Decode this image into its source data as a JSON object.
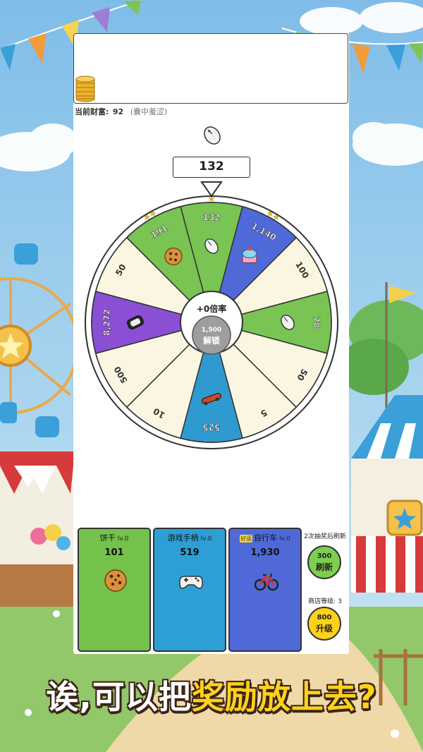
{
  "wealth": {
    "label": "当前财富:",
    "value": "92",
    "status": "(囊中羞涩)"
  },
  "result": "132",
  "wheel": {
    "center_multiplier": "+0倍率",
    "center_cost": "1,500",
    "center_unlock": "解锁",
    "slices": [
      {
        "value": "132",
        "color": "#79c453",
        "icon": "mouse-icon",
        "stars": 1
      },
      {
        "value": "1,140",
        "color": "#4f6ad8",
        "icon": "cake-icon",
        "stars": 2
      },
      {
        "value": "100",
        "color": "#fbf6e2",
        "icon": "",
        "stars": 0
      },
      {
        "value": "78",
        "color": "#79c453",
        "icon": "mouse-icon",
        "stars": 0
      },
      {
        "value": "50",
        "color": "#fbf6e2",
        "icon": "",
        "stars": 0
      },
      {
        "value": "5",
        "color": "#fbf6e2",
        "icon": "",
        "stars": 0
      },
      {
        "value": "525",
        "color": "#2f9ad0",
        "icon": "skateboard-icon",
        "stars": 0
      },
      {
        "value": "10",
        "color": "#fbf6e2",
        "icon": "",
        "stars": 0
      },
      {
        "value": "500",
        "color": "#fbf6e2",
        "icon": "",
        "stars": 0
      },
      {
        "value": "8,272",
        "color": "#8b4fd6",
        "icon": "vr-headset-icon",
        "stars": 0
      },
      {
        "value": "50",
        "color": "#fbf6e2",
        "icon": "",
        "stars": 0
      },
      {
        "value": "191",
        "color": "#79c453",
        "icon": "cookie-icon",
        "stars": 2
      }
    ]
  },
  "shop": {
    "cards": [
      {
        "name": "饼干",
        "level": "lv.0",
        "price": "101",
        "tag": "",
        "icon": "cookie-icon",
        "color": "#74c24c"
      },
      {
        "name": "游戏手柄",
        "level": "lv.0",
        "price": "519",
        "tag": "",
        "icon": "gamepad-icon",
        "color": "#2e9fd4"
      },
      {
        "name": "自行车",
        "level": "lv.0",
        "price": "1,930",
        "tag": "好运",
        "icon": "bicycle-icon",
        "color": "#4f6ad8"
      }
    ],
    "refresh_note": "2次抽奖后刷新",
    "refresh_cost": "300",
    "refresh_label": "刷新",
    "shop_level_label": "商店等级:",
    "shop_level": "3",
    "upgrade_cost": "800",
    "upgrade_label": "升级",
    "refresh_color": "#7dd04f",
    "upgrade_color": "#ffd21a"
  },
  "caption": {
    "part1": "诶,可以把",
    "part2": "奖励放上去?"
  }
}
